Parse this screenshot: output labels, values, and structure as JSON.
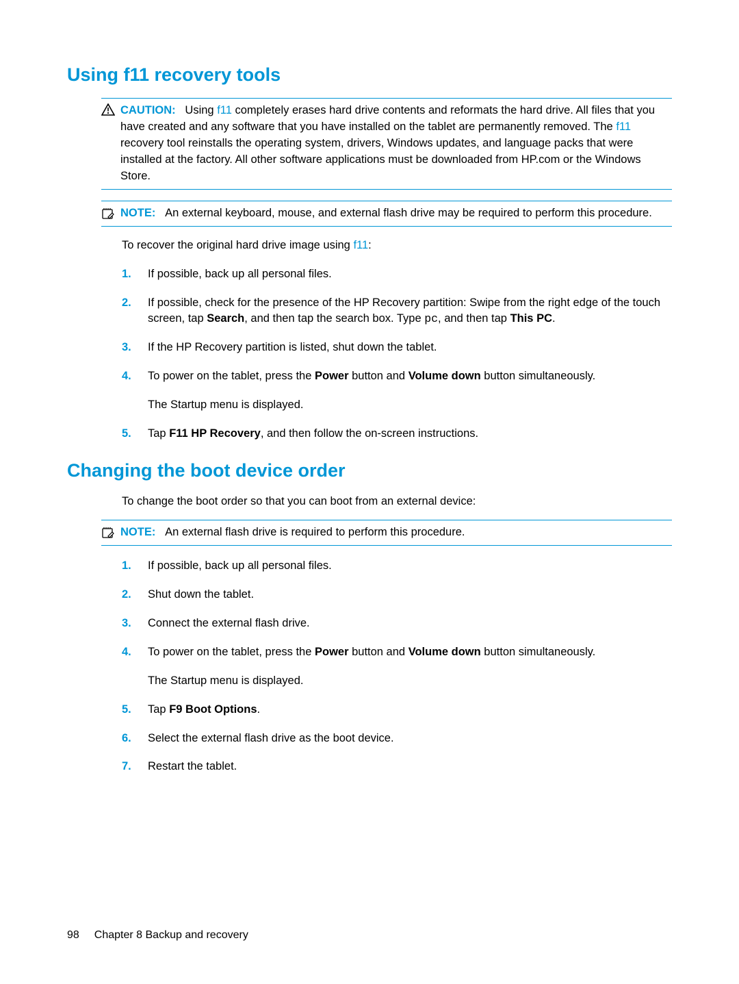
{
  "section1": {
    "heading": "Using f11 recovery tools",
    "caution": {
      "label": "CAUTION:",
      "text_a": "Using ",
      "f11a": "f11",
      "text_b": " completely erases hard drive contents and reformats the hard drive. All files that you have created and any software that you have installed on the tablet are permanently removed. The ",
      "f11b": "f11",
      "text_c": " recovery tool reinstalls the operating system, drivers, Windows updates, and language packs that were installed at the factory. All other software applications must be downloaded from HP.com or the Windows Store."
    },
    "note": {
      "label": "NOTE:",
      "text": "An external keyboard, mouse, and external flash drive may be required to perform this procedure."
    },
    "intro_a": "To recover the original hard drive image using ",
    "intro_f11": "f11",
    "intro_b": ":",
    "steps": {
      "s1": {
        "num": "1.",
        "text": "If possible, back up all personal files."
      },
      "s2": {
        "num": "2.",
        "a": "If possible, check for the presence of the HP Recovery partition: Swipe from the right edge of the touch screen, tap ",
        "b_search": "Search",
        "c": ", and then tap the search box. Type ",
        "pc": "pc",
        "d": ", and then tap ",
        "thispc": "This PC",
        "e": "."
      },
      "s3": {
        "num": "3.",
        "text": "If the HP Recovery partition is listed, shut down the tablet."
      },
      "s4": {
        "num": "4.",
        "a": "To power on the tablet, press the ",
        "power": "Power",
        "b": " button and ",
        "voldown": "Volume down",
        "c": " button simultaneously.",
        "sub": "The Startup menu is displayed."
      },
      "s5": {
        "num": "5.",
        "a": "Tap ",
        "f11rec": "F11 HP Recovery",
        "b": ", and then follow the on-screen instructions."
      }
    }
  },
  "section2": {
    "heading": "Changing the boot device order",
    "intro": "To change the boot order so that you can boot from an external device:",
    "note": {
      "label": "NOTE:",
      "text": "An external flash drive is required to perform this procedure."
    },
    "steps": {
      "s1": {
        "num": "1.",
        "text": "If possible, back up all personal files."
      },
      "s2": {
        "num": "2.",
        "text": "Shut down the tablet."
      },
      "s3": {
        "num": "3.",
        "text": "Connect the external flash drive."
      },
      "s4": {
        "num": "4.",
        "a": "To power on the tablet, press the ",
        "power": "Power",
        "b": " button and ",
        "voldown": "Volume down",
        "c": " button simultaneously.",
        "sub": "The Startup menu is displayed."
      },
      "s5": {
        "num": "5.",
        "a": "Tap ",
        "f9": "F9 Boot Options",
        "b": "."
      },
      "s6": {
        "num": "6.",
        "text": "Select the external flash drive as the boot device."
      },
      "s7": {
        "num": "7.",
        "text": "Restart the tablet."
      }
    }
  },
  "footer": {
    "page": "98",
    "chapter": "Chapter 8   Backup and recovery"
  }
}
